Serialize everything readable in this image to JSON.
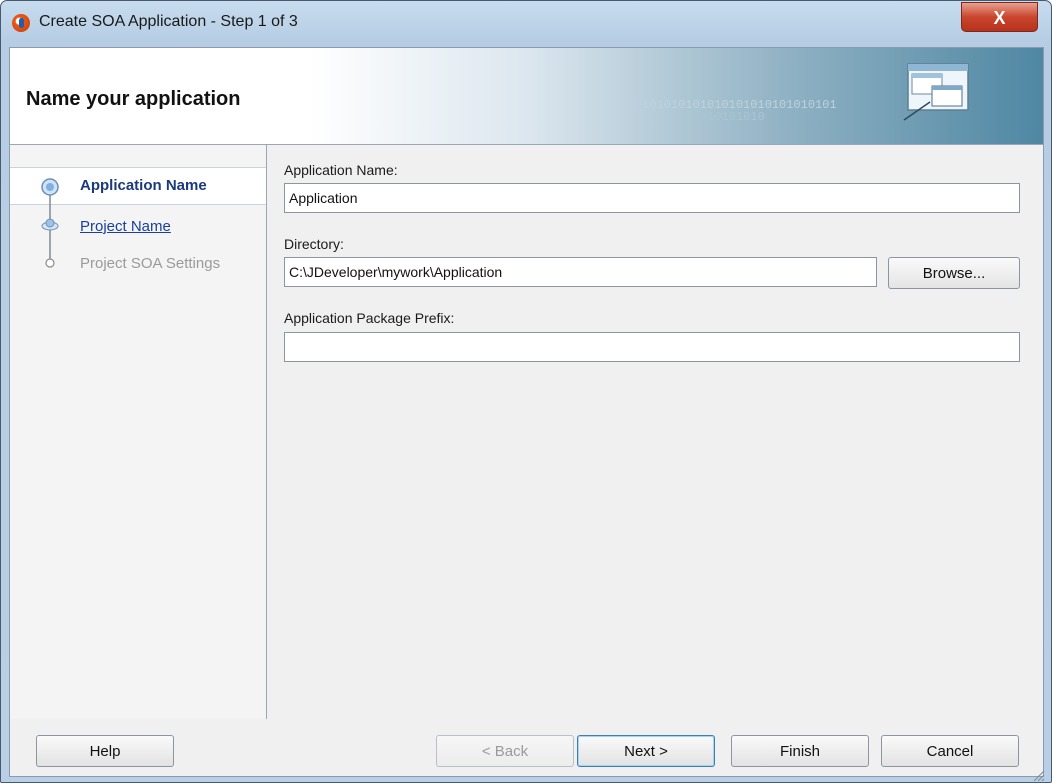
{
  "window": {
    "title": "Create SOA Application - Step 1 of 3",
    "close_label": "X"
  },
  "banner": {
    "title": "Name your application",
    "binary_line1": "0101010101010101010101010101",
    "binary_line2": "010101010"
  },
  "steps": [
    {
      "label": "Application Name",
      "state": "active"
    },
    {
      "label": "Project Name",
      "state": "link"
    },
    {
      "label": "Project SOA Settings",
      "state": "disabled"
    }
  ],
  "form": {
    "app_name_label": "Application Name:",
    "app_name_value": "Application",
    "directory_label": "Directory:",
    "directory_value": "C:\\JDeveloper\\mywork\\Application",
    "browse_label": "Browse...",
    "package_prefix_label": "Application Package Prefix:",
    "package_prefix_value": ""
  },
  "footer": {
    "help": "Help",
    "back": "< Back",
    "next": "Next >",
    "finish": "Finish",
    "cancel": "Cancel"
  },
  "colors": {
    "accent": "#1b3a7a",
    "link": "#1a3fa0",
    "close": "#c9452c"
  }
}
